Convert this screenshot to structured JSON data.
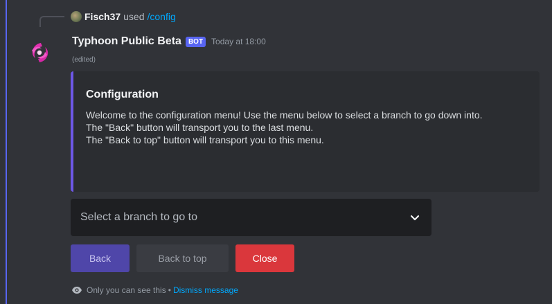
{
  "reply": {
    "user": "Fisch37",
    "action": "used",
    "command": "/config"
  },
  "message": {
    "author": "Typhoon Public Beta",
    "badge": "BOT",
    "timestamp": "Today at 18:00",
    "edited": "(edited)"
  },
  "embed": {
    "accent_color": "#6d57e6",
    "title": "Configuration",
    "description_lines": [
      "Welcome to the configuration menu! Use the menu below to select a branch to go down into.",
      "The \"Back\" button will transport you to the last menu.",
      "The \"Back to top\" button will transport you to this menu."
    ]
  },
  "select": {
    "placeholder": "Select a branch to go to",
    "icon": "chevron-down-icon"
  },
  "buttons": {
    "back": "Back",
    "back_to_top": "Back to top",
    "close": "Close"
  },
  "footer": {
    "icon": "eye-icon",
    "text": "Only you can see this",
    "separator": "•",
    "link": "Dismiss message"
  },
  "colors": {
    "background": "#313338",
    "blurple": "#5865f2",
    "danger": "#da373c",
    "link": "#00a8fc"
  }
}
